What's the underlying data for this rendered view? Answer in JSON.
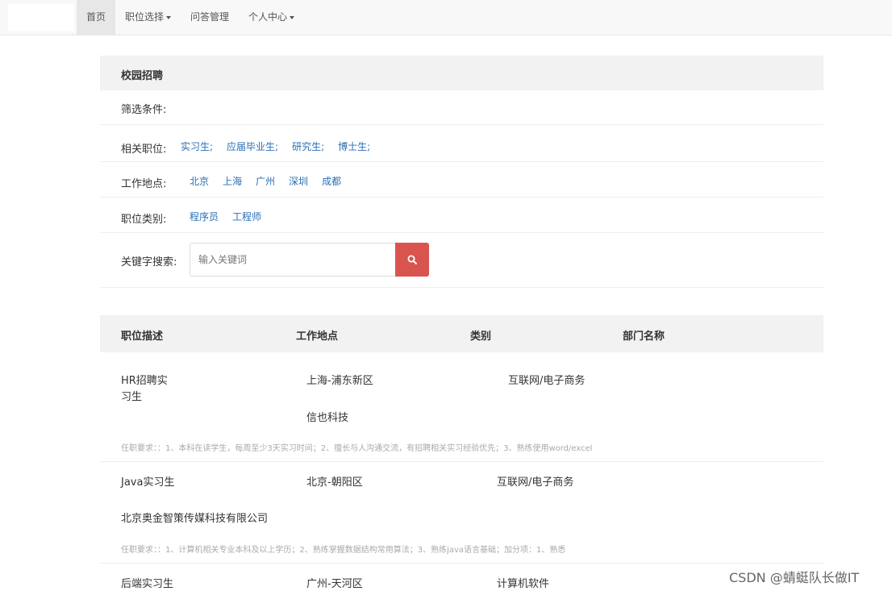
{
  "nav": {
    "items": [
      {
        "label": "首页",
        "active": true,
        "dropdown": false
      },
      {
        "label": "职位选择",
        "active": false,
        "dropdown": true
      },
      {
        "label": "问答管理",
        "active": false,
        "dropdown": false
      },
      {
        "label": "个人中心",
        "active": false,
        "dropdown": true
      }
    ]
  },
  "filter": {
    "title": "校园招聘",
    "criteria_label": "筛选条件:",
    "position_label": "相关职位:",
    "positions": [
      "实习生;",
      "应届毕业生;",
      "研究生;",
      "博士生;"
    ],
    "location_label": "工作地点:",
    "locations": [
      "北京",
      "上海",
      "广州",
      "深圳",
      "成都"
    ],
    "category_label": "职位类别:",
    "categories": [
      "程序员",
      "工程师"
    ],
    "keyword_label": "关键字搜索:",
    "keyword_placeholder": "输入关键词",
    "search_icon": "search-icon"
  },
  "table": {
    "headers": [
      "职位描述",
      "工作地点",
      "类别",
      "部门名称"
    ],
    "rows": [
      {
        "title_line1": "HR招聘实",
        "title_line2": "习生",
        "location": "上海-浦东新区",
        "category": "互联网/电子商务",
        "company": "信也科技",
        "requirement": "任职要求：：1、本科在读学生，每周至少3天实习时间；2、擅长与人沟通交流，有招聘相关实习经验优先；3、熟练使用word/excel"
      },
      {
        "title": "Java实习生",
        "location": "北京-朝阳区",
        "category": "互联网/电子商务",
        "company": "北京奥金智策传媒科技有限公司",
        "requirement": "任职要求：：1、计算机相关专业本科及以上学历；2、熟练掌握数据结构常用算法；3、熟练java语言基础；加分项：1、熟悉"
      },
      {
        "title": "后端实习生",
        "location": "广州-天河区",
        "category": "计算机软件"
      }
    ]
  },
  "watermark": "CSDN @蜻蜓队长做IT"
}
